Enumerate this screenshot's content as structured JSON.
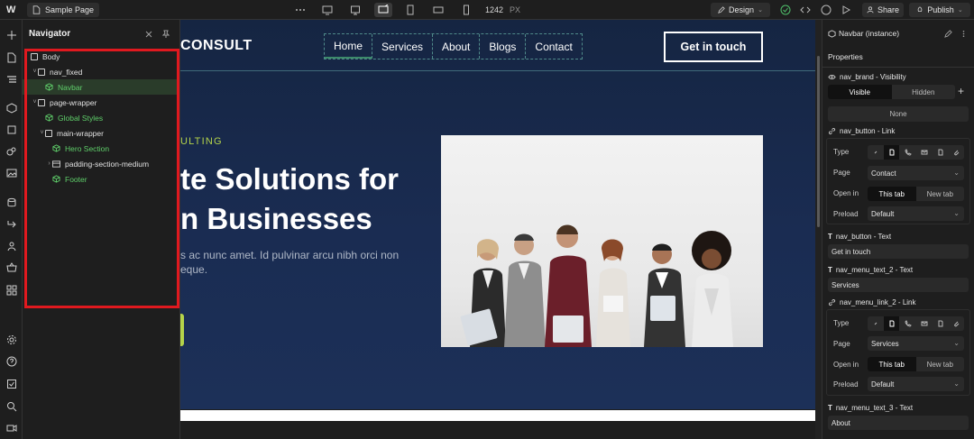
{
  "topbar": {
    "logo": "W",
    "page_name": "Sample Page",
    "width_value": "1242",
    "width_unit": "PX",
    "mode_label": "Design",
    "share_label": "Share",
    "publish_label": "Publish"
  },
  "navigator": {
    "title": "Navigator",
    "tree": [
      {
        "label": "Body",
        "indent": 0,
        "kind": "box",
        "caret": ""
      },
      {
        "label": "nav_fixed",
        "indent": 1,
        "kind": "box",
        "caret": "v"
      },
      {
        "label": "Navbar",
        "indent": 2,
        "kind": "component",
        "caret": ""
      },
      {
        "label": "page-wrapper",
        "indent": 1,
        "kind": "box",
        "caret": "v"
      },
      {
        "label": "Global Styles",
        "indent": 2,
        "kind": "component",
        "caret": ""
      },
      {
        "label": "main-wrapper",
        "indent": 2,
        "kind": "box",
        "caret": "v"
      },
      {
        "label": "Hero Section",
        "indent": 3,
        "kind": "component",
        "caret": ""
      },
      {
        "label": "padding-section-medium",
        "indent": 3,
        "kind": "section",
        "caret": ">"
      },
      {
        "label": "Footer",
        "indent": 3,
        "kind": "component",
        "caret": ""
      }
    ]
  },
  "site": {
    "brand": "CONSULT",
    "menu": [
      "Home",
      "Services",
      "About",
      "Blogs",
      "Contact"
    ],
    "cta": "Get in touch",
    "eyebrow": "ULTING",
    "title_line1": "te Solutions for",
    "title_line2": "n Businesses",
    "text_line1": "s ac nunc amet. Id pulvinar arcu nibh orci non",
    "text_line2": "eque."
  },
  "props": {
    "title": "Navbar (instance)",
    "tab": "Properties",
    "visibility_label": "nav_brand - Visibility",
    "visible": "Visible",
    "hidden": "Hidden",
    "none_label": "None",
    "link1_label": "nav_button - Link",
    "type_label": "Type",
    "page_label": "Page",
    "page1_value": "Contact",
    "openin_label": "Open in",
    "this_tab": "This tab",
    "new_tab": "New tab",
    "preload_label": "Preload",
    "preload1_value": "Default",
    "text1_label": "nav_button - Text",
    "text1_value": "Get in touch",
    "text2_label": "nav_menu_text_2 - Text",
    "text2_value": "Services",
    "link2_label": "nav_menu_link_2 - Link",
    "page2_value": "Services",
    "preload2_value": "Default",
    "text3_label": "nav_menu_text_3 - Text",
    "text3_value": "About"
  }
}
